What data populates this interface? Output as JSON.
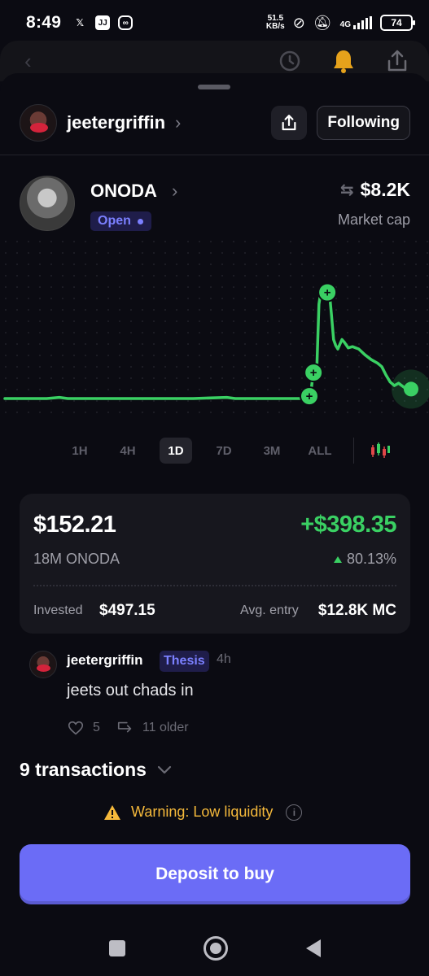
{
  "status_bar": {
    "time": "8:49",
    "net_speed_value": "51.5",
    "net_speed_unit": "KB/s",
    "network": "4G",
    "battery": "74"
  },
  "profile": {
    "username": "jeetergriffin",
    "follow_label": "Following"
  },
  "token": {
    "name": "ONODA",
    "status": "Open",
    "market_cap": "$8.2K",
    "market_cap_label": "Market cap"
  },
  "chart_data": {
    "type": "line",
    "title": "",
    "xlabel": "",
    "ylabel": "",
    "selected_range": "1D",
    "color": "#3ad063",
    "points": [
      [
        0,
        0.0
      ],
      [
        0.05,
        0.0
      ],
      [
        0.1,
        0.0
      ],
      [
        0.13,
        0.01
      ],
      [
        0.15,
        0.0
      ],
      [
        0.25,
        0.0
      ],
      [
        0.35,
        0.0
      ],
      [
        0.45,
        0.0
      ],
      [
        0.53,
        0.01
      ],
      [
        0.55,
        0.0
      ],
      [
        0.65,
        0.0
      ],
      [
        0.72,
        0.0
      ],
      [
        0.73,
        0.03
      ],
      [
        0.735,
        0.18
      ],
      [
        0.745,
        0.28
      ],
      [
        0.75,
        0.8
      ],
      [
        0.755,
        0.92
      ],
      [
        0.76,
        0.95
      ],
      [
        0.765,
        0.85
      ],
      [
        0.77,
        0.88
      ],
      [
        0.775,
        0.9
      ],
      [
        0.78,
        0.7
      ],
      [
        0.785,
        0.5
      ],
      [
        0.79,
        0.45
      ],
      [
        0.795,
        0.42
      ],
      [
        0.8,
        0.46
      ],
      [
        0.805,
        0.5
      ],
      [
        0.81,
        0.48
      ],
      [
        0.82,
        0.43
      ],
      [
        0.83,
        0.44
      ],
      [
        0.845,
        0.42
      ],
      [
        0.86,
        0.37
      ],
      [
        0.875,
        0.33
      ],
      [
        0.89,
        0.3
      ],
      [
        0.9,
        0.27
      ],
      [
        0.91,
        0.2
      ],
      [
        0.92,
        0.14
      ],
      [
        0.93,
        0.11
      ],
      [
        0.94,
        0.13
      ],
      [
        0.955,
        0.09
      ],
      [
        0.97,
        0.08
      ]
    ],
    "markers": [
      {
        "x": 0.727,
        "y": 0.02,
        "label": "+"
      },
      {
        "x": 0.737,
        "y": 0.22,
        "label": "+"
      },
      {
        "x": 0.77,
        "y": 0.9,
        "label": "+"
      }
    ],
    "ranges": [
      "1H",
      "4H",
      "1D",
      "7D",
      "3M",
      "ALL"
    ]
  },
  "position": {
    "value": "$152.21",
    "pnl": "+$398.35",
    "amount": "18M ONODA",
    "pnl_pct": "80.13%",
    "invested_label": "Invested",
    "invested_value": "$497.15",
    "avg_entry_label": "Avg. entry",
    "avg_entry_value": "$12.8K MC"
  },
  "post": {
    "username": "jeetergriffin",
    "tag": "Thesis",
    "time": "4h",
    "text": "jeets out chads in",
    "likes": "5",
    "older": "11 older"
  },
  "transactions_label": "9 transactions",
  "warning_text": "Warning: Low liquidity",
  "deposit_label": "Deposit to buy",
  "icons": {
    "back": "chevron-left-icon",
    "history": "history-icon",
    "bell": "bell-icon",
    "share": "share-icon"
  }
}
